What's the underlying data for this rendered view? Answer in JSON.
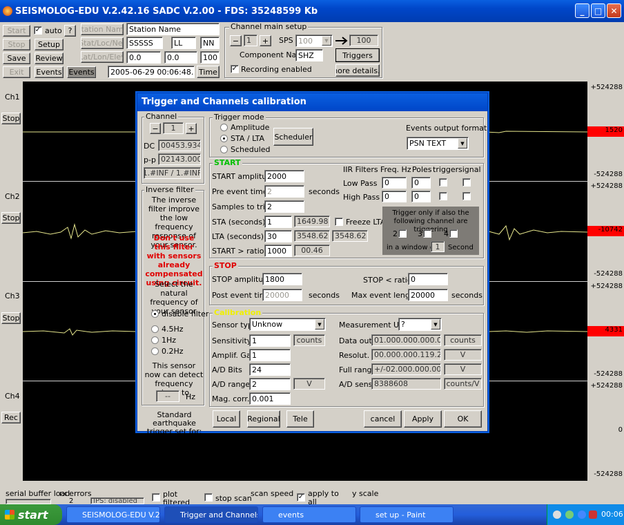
{
  "window": {
    "title": "SEISMOLOG-EDU V.2.42.16 SADC V.2.00 - FDS: 35248599 Kb",
    "min": "_",
    "max": "□",
    "close": "✕"
  },
  "toolbar": {
    "start": "Start",
    "auto_label": "auto",
    "help": "?",
    "station_name_btn": "Station Name",
    "station_name": "Station Name",
    "stop": "Stop",
    "setup": "Setup",
    "stat_loc_net_btn": "Stat/Loc/Net",
    "stat": "SSSSS",
    "loc": "LL",
    "net": "NN",
    "save": "Save",
    "review": "Review",
    "lat_lon_elev_btn": "Lat/Lon/Elev",
    "lat": "0.0",
    "lon": "0.0",
    "elev": "100",
    "exit": "Exit",
    "events": "Events",
    "events2": "Events",
    "datetime": "2005-06-29 00:06:48.200",
    "time_btn": "Time"
  },
  "channel_setup": {
    "title": "Channel main setup",
    "minus": "−",
    "ch": "1",
    "plus": "+",
    "sps_label": "SPS",
    "sps": "100",
    "sps_out": "100",
    "component_label": "Component Name:",
    "component": "SHZ",
    "triggers": "Triggers",
    "recording": "Recording enabled",
    "more": "more details..."
  },
  "left_panel": {
    "ch1": "Ch1",
    "stop1": "Stop",
    "ch2": "Ch2",
    "stop2": "Stop",
    "ch3": "Ch3",
    "stop3": "Stop",
    "ch4": "Ch4",
    "rec": "Rec"
  },
  "scale": {
    "s1top": "+524288",
    "s1val": "1520",
    "s1bot": "-524288",
    "s2top": "+524288",
    "s2val": "-10742",
    "s2bot": "-524288",
    "s3top": "+524288",
    "s3val": "4331",
    "s3bot": "-524288",
    "s4top": "+524288",
    "s4mid": "0",
    "s4bot": "-524288"
  },
  "bottom": {
    "serial": "serial buffer load",
    "rx": "rx errors",
    "rx_val": "2",
    "ips": "IPS: disabled",
    "plot_filtered": "plot filtered waveforms",
    "stop_scan": "stop scan",
    "scan_speed": "scan speed",
    "apply_all": "apply to all channels",
    "yscale": "y scale"
  },
  "taskbar": {
    "start": "start",
    "t1": "SEISMOLOG-EDU V.2...",
    "t2": "Trigger and Channels...",
    "t3": "events",
    "t4": "set up - Paint",
    "clock": "00:06"
  },
  "dialog": {
    "title": "Trigger and Channels calibration",
    "channel": {
      "title": "Channel",
      "minus": "−",
      "num": "1",
      "plus": "+",
      "dc_label": "DC",
      "dc": "00453.934",
      "pp_label": "p-p",
      "pp": "02143.000",
      "inf": "1.#INF / 1.#INF"
    },
    "inverse": {
      "title": "Inverse filter",
      "desc": "The inverse filter improve the low frequency response of your sensor.",
      "warn": "Don't use this filter with sensors already compensated using circuit.",
      "select": "Select the natural frequency of your sensor",
      "opt0": "disable filter",
      "opt1": "4.5Hz",
      "opt2": "1Hz",
      "opt3": "0.2Hz",
      "detect": "This sensor now can detect frequency down to",
      "detect_val": "--",
      "hz": "Hz"
    },
    "trigger_mode": {
      "title": "Trigger mode",
      "amplitude": "Amplitude",
      "stalta": "STA / LTA",
      "scheduled": "Scheduled",
      "scheduler": "Scheduler",
      "output_label": "Events output format",
      "output": "PSN TEXT"
    },
    "start": {
      "title": "START",
      "amp_label": "START amplitude",
      "amp": "2000",
      "pre_label": "Pre event time",
      "pre": "2",
      "seconds": "seconds",
      "samples_label": "Samples to trig.",
      "samples": "2",
      "sta_label": "STA (seconds)",
      "sta": "1",
      "sta_val": "1649.98",
      "freeze": "Freeze LTA",
      "lta_label": "LTA (seconds)",
      "lta": "30",
      "lta_val1": "3548.62",
      "lta_val2": "3548.62",
      "ratio_label": "START > ratio",
      "ratio": "1000",
      "ratio_val": "00.46"
    },
    "iir": {
      "title": "IIR Filters",
      "freq": "Freq. Hz",
      "poles": "Poles",
      "trigger": "trigger",
      "signal": "signal",
      "lp": "Low Pass",
      "lp_f": "0",
      "lp_p": "0",
      "hp": "High Pass",
      "hp_f": "0",
      "hp_p": "0"
    },
    "also": {
      "text": "Trigger only if also the following channel are triggering",
      "c2": "2",
      "c3": "3",
      "c4": "4",
      "window": "in a window of",
      "wval": "1",
      "second": "Second"
    },
    "stop": {
      "title": "STOP",
      "amp_label": "STOP amplitude",
      "amp": "1800",
      "post_label": "Post event time",
      "post": "20000",
      "seconds": "seconds",
      "ratio_label": "STOP < ratio",
      "ratio": "0",
      "maxlen_label": "Max event length",
      "maxlen": "20000",
      "seconds2": "seconds"
    },
    "cal": {
      "title": "Calibration",
      "sensor_label": "Sensor type",
      "sensor": "Unknow",
      "unit_label": "Measurement Unit",
      "unit": "?",
      "sens_label": "Sensitivity",
      "sens": "1",
      "counts": "counts",
      "gain_label": "Amplif. Gain",
      "gain": "1",
      "bits_label": "A/D Bits",
      "bits": "24",
      "range_label": "A/D range",
      "range": "2",
      "v": "V",
      "mag_label": "Mag. corr.",
      "mag": "0.001",
      "dataout_label": "Data out",
      "dataout": "01.000.000.000.000",
      "dataout_u": "counts",
      "resol_label": "Resolut.",
      "resol": "00.000.000.119.209",
      "resol_u": "V",
      "full_label": "Full range",
      "full": "+/-02.000.000.000.000",
      "full_u": "V",
      "adsens_label": "A/D sens.",
      "adsens": "8388608",
      "adsens_u": "counts/V"
    },
    "footer": {
      "std": "Standard earthquake trigger set for:",
      "local": "Local",
      "regional": "Regional",
      "tele": "Tele",
      "cancel": "cancel",
      "apply": "Apply",
      "ok": "OK"
    }
  }
}
